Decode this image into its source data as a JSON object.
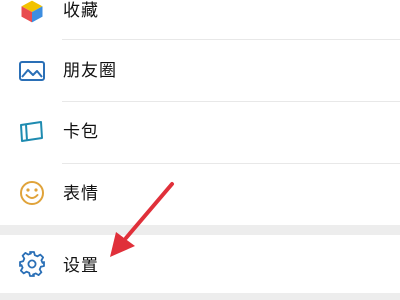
{
  "menu": {
    "items": [
      {
        "label": "收藏",
        "icon": "favorites-cube-icon"
      },
      {
        "label": "朋友圈",
        "icon": "moments-picture-icon"
      },
      {
        "label": "卡包",
        "icon": "card-wallet-icon"
      },
      {
        "label": "表情",
        "icon": "sticker-smile-icon"
      }
    ],
    "settings": {
      "label": "设置",
      "icon": "gear-icon"
    }
  },
  "annotation": {
    "arrow_color": "#e0303a"
  },
  "colors": {
    "background": "#ededed",
    "row_background": "#ffffff",
    "divider": "#e8e8e8",
    "moments_blue": "#2a6fb6",
    "card_teal": "#1e8bb0",
    "sticker_orange": "#e0a33a",
    "settings_blue": "#2a6fb6"
  }
}
